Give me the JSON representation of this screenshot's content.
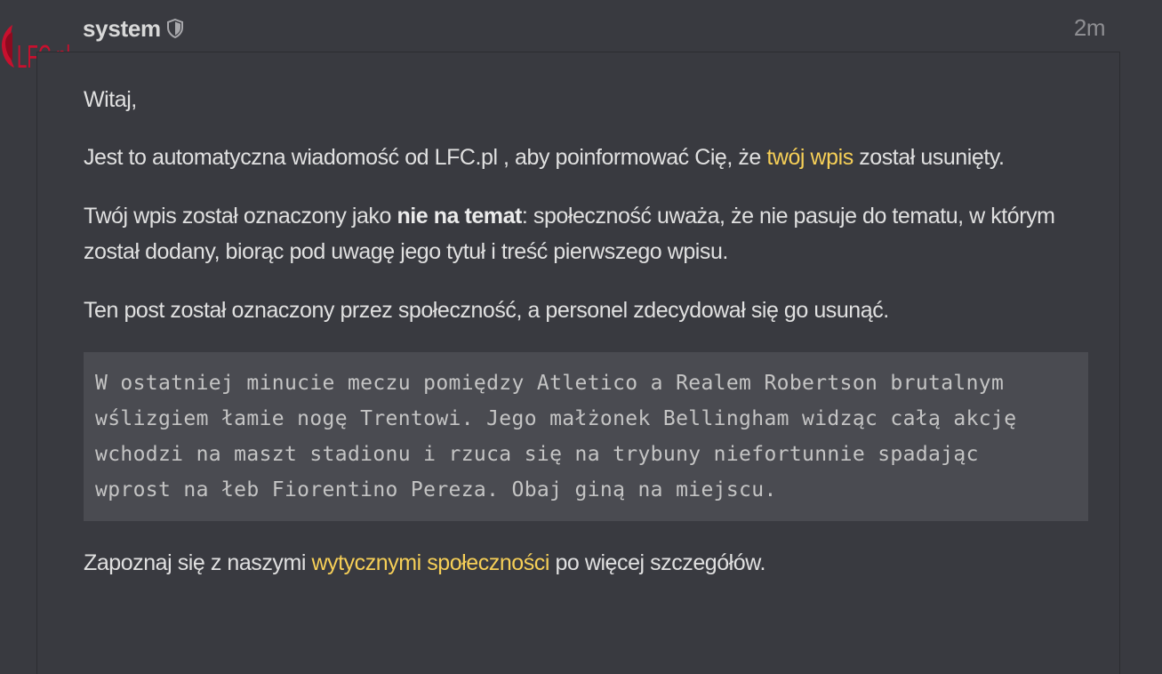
{
  "avatar": {
    "logo_text": "LFC.pl",
    "color": "#c8102e"
  },
  "header": {
    "username": "system",
    "badge_icon": "shield-icon",
    "time": "2m"
  },
  "post": {
    "greeting": "Witaj,",
    "intro_before": "Jest to automatyczna wiadomość od LFC.pl , aby poinformować Cię, że ",
    "intro_link": "twój wpis",
    "intro_after": " został usunięty.",
    "reason_before": "Twój wpis został oznaczony jako ",
    "reason_bold": "nie na temat",
    "reason_after": ": społeczność uważa, że nie pasuje do tematu, w którym został dodany, biorąc pod uwagę jego tytuł i treść pierwszego wpisu.",
    "flag_text": "Ten post został oznaczony przez społeczność, a personel zdecydował się go usunąć.",
    "quote_lines": [
      "W ostatniej minucie meczu pomiędzy Atletico a Realem Robertson brutalnym",
      "wślizgiem łamie nogę Trentowi. Jego małżonek Bellingham widząc całą akcję",
      "wchodzi na maszt stadionu i rzuca się na trybuny niefortunnie spadając",
      "wprost na łeb Fiorentino Pereza. Obaj giną na miejscu."
    ],
    "footer_before": "Zapoznaj się z naszymi ",
    "footer_link": "wytycznymi społeczności",
    "footer_after": " po więcej szczegółów."
  },
  "colors": {
    "background": "#393a40",
    "link": "#f6cf57",
    "quote_background": "#4a4b51"
  }
}
